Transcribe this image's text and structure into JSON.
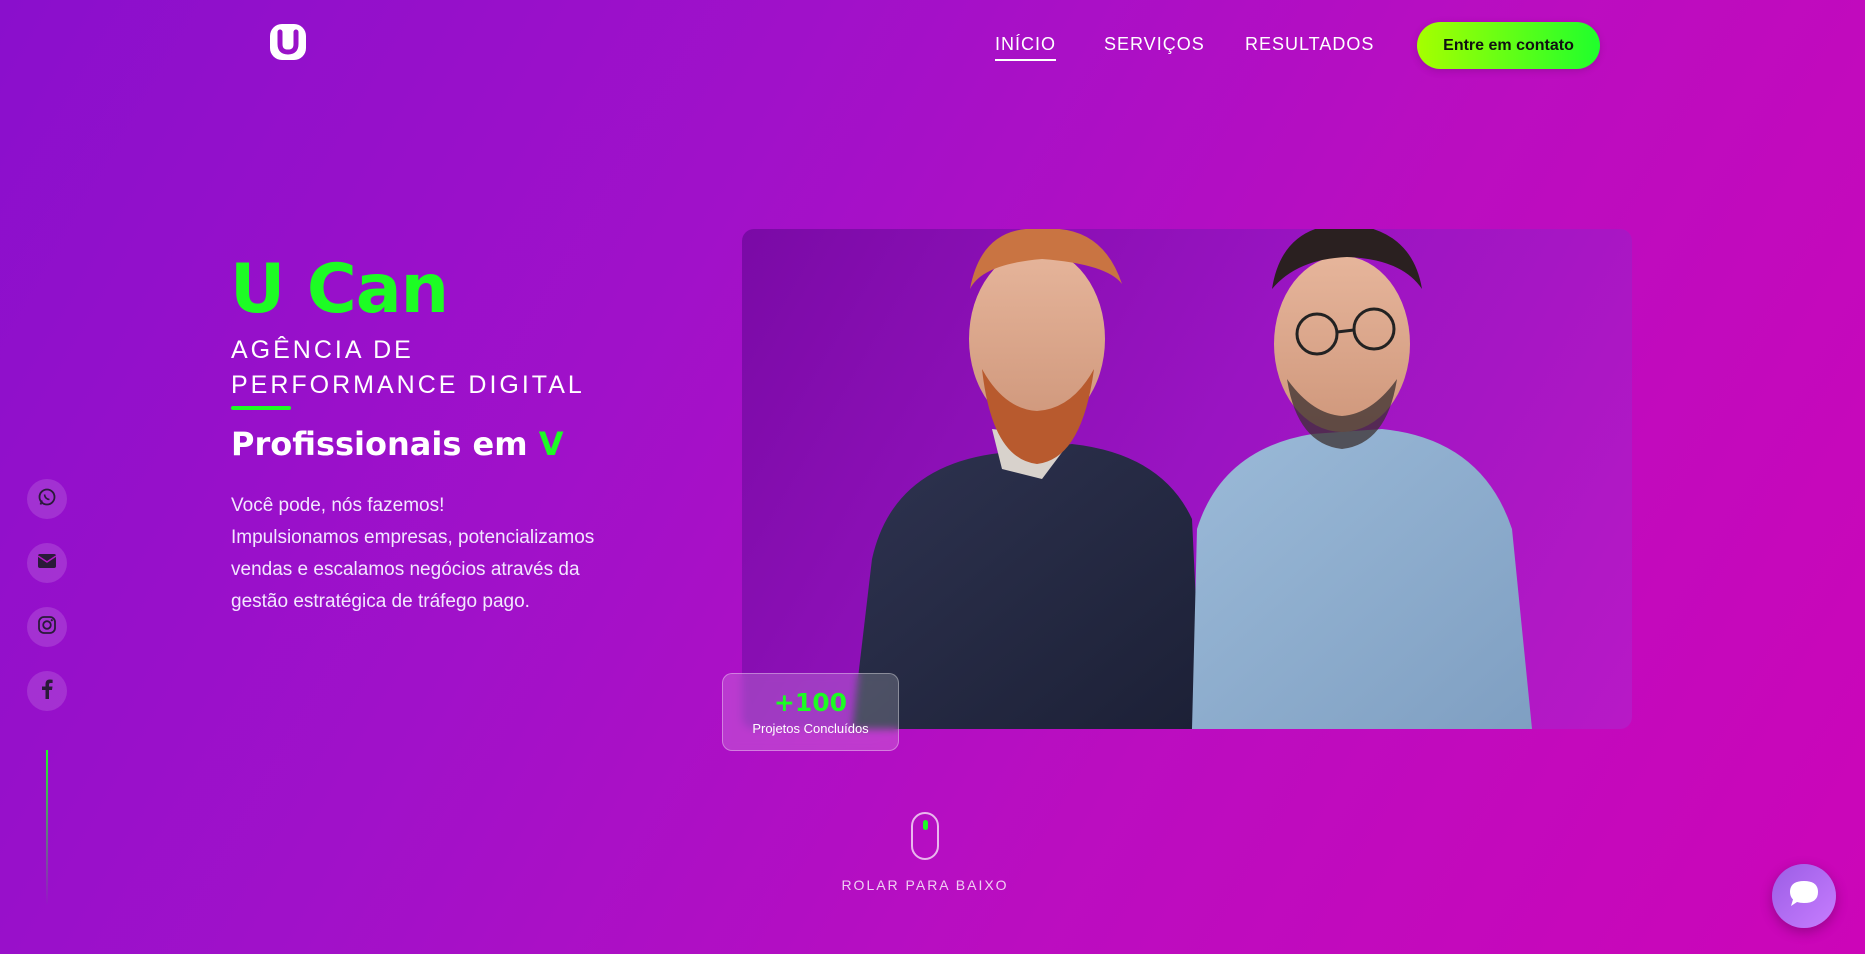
{
  "nav": {
    "items": [
      {
        "label": "INÍCIO",
        "active": true
      },
      {
        "label": "SERVIÇOS",
        "active": false
      },
      {
        "label": "RESULTADOS",
        "active": false
      }
    ],
    "cta_label": "Entre em contato"
  },
  "hero": {
    "brand": "U Can",
    "subtitle": "AGÊNCIA DE PERFORMANCE DIGITAL",
    "tagline_prefix": "Profissionais em ",
    "tagline_highlight": "V",
    "description_line1": "Você pode, nós fazemos!",
    "description_line2": "Impulsionamos empresas, potencializamos vendas e escalamos negócios através da gestão estratégica de tráfego pago."
  },
  "stat": {
    "number": "+100",
    "label": "Projetos Concluídos"
  },
  "social": [
    {
      "icon": "whatsapp-icon"
    },
    {
      "icon": "mail-icon"
    },
    {
      "icon": "instagram-icon"
    },
    {
      "icon": "facebook-icon"
    }
  ],
  "scroll": {
    "label": "ROLAR PARA BAIXO"
  },
  "colors": {
    "accent_green": "#1dfc24",
    "background_start": "#8a0fcc",
    "background_end": "#cc05b8"
  }
}
